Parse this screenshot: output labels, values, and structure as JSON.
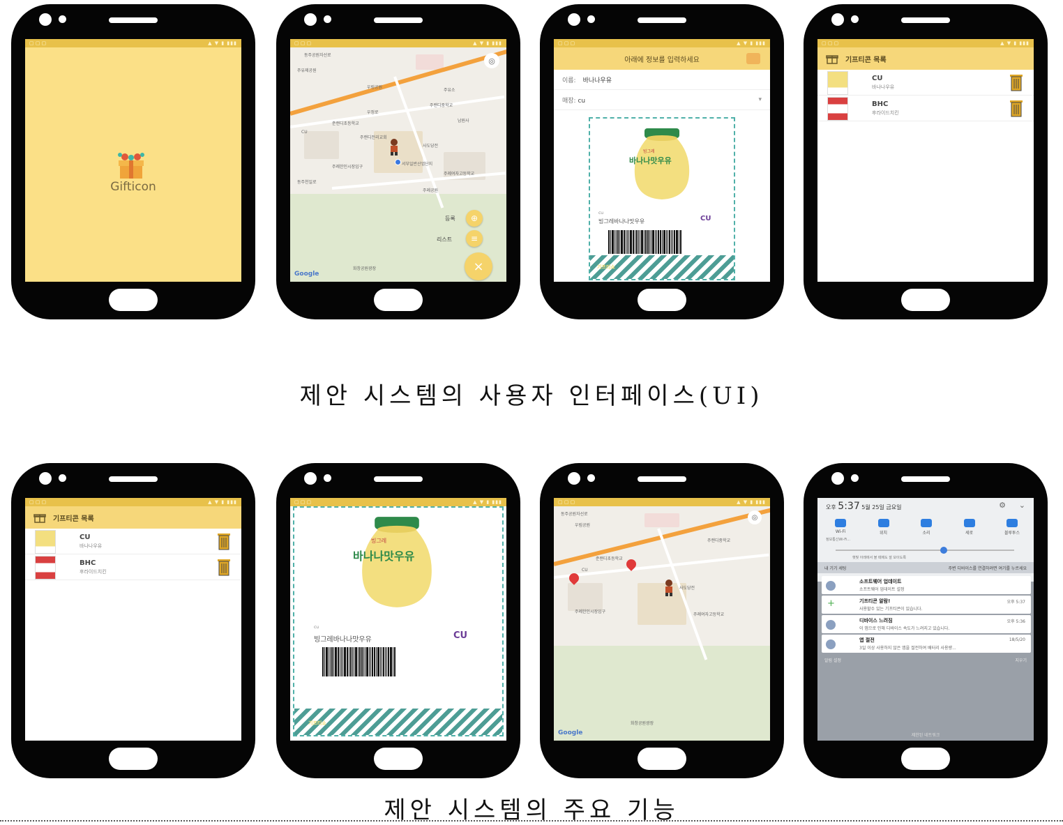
{
  "captions": {
    "top": "제안 시스템의 사용자 인터페이스(UI)",
    "bottom": "제안 시스템의 주요 기능"
  },
  "splash": {
    "app_name": "Gifticon"
  },
  "map_screen": {
    "register_label": "등록",
    "list_label": "리스트",
    "google": "Google",
    "places": [
      "동주공원자선로",
      "주유제공원",
      "우림공원",
      "주유소",
      "주랜디중학교",
      "준랜디초등학교",
      "남원사",
      "우정로",
      "CU",
      "주랜디전리교회",
      "사도당전",
      "주례한인시장입구",
      "서부일반산업단지",
      "주례여자고등학교",
      "동주천일로",
      "주례공원",
      "화창공원광장"
    ]
  },
  "form_screen": {
    "header": "아래에 정보를 입력하세요",
    "name_label": "이름:",
    "name_value": "바나나우유",
    "store_label": "매장:",
    "store_value": "cu"
  },
  "coupon": {
    "brand_small": "cu",
    "product_name": "빙그레바나나맛우유",
    "product_text": "바나나맛우유",
    "maker": "빙그레",
    "store_logo": "CU",
    "stripe_text": "기프티쇼"
  },
  "list_screen": {
    "header": "기프티콘 목록",
    "items": [
      {
        "store": "CU",
        "product": "바나나우유",
        "thumb": "바나나우유"
      },
      {
        "store": "BHC",
        "product": "후라이드치킨",
        "thumb": "BHC치킨"
      }
    ]
  },
  "notif_screen": {
    "ampm": "오후",
    "time": "5:37",
    "date": "5월 25일 금요일",
    "quick": [
      "Wi-Fi",
      "위치",
      "소리",
      "세로",
      "블루투스"
    ],
    "wifi_sub": "정보통신Wi-Fi...",
    "brightness_hint": "햇빛 아래에서 볼 때에도 잘 보이도록",
    "tab_left": "내 기기 세팅",
    "tab_right": "주변 디바이스를 연결하려면 여기를 누르세요",
    "notifications": [
      {
        "title": "소프트웨어 업데이트",
        "sub": "소프트웨어 업데이트 설정",
        "time": ""
      },
      {
        "title": "기프티콘 알람!",
        "sub": "사용할수 있는 기프티콘이 있습니다.",
        "time": "오후 5:37"
      },
      {
        "title": "디바이스 느려짐",
        "sub": "이 앱으로 인해 디바이스 속도가 느려지고 있습니다.",
        "time": "오후 5:36"
      },
      {
        "title": "앱 절전",
        "sub": "3일 이상 사용하지 않은 앱을 절전하여 배터리 사용량...",
        "time": "18/5/20"
      }
    ],
    "footer_left": "알림 설정",
    "footer_right": "지우기",
    "bottom_text": "제한된 네트워크"
  }
}
